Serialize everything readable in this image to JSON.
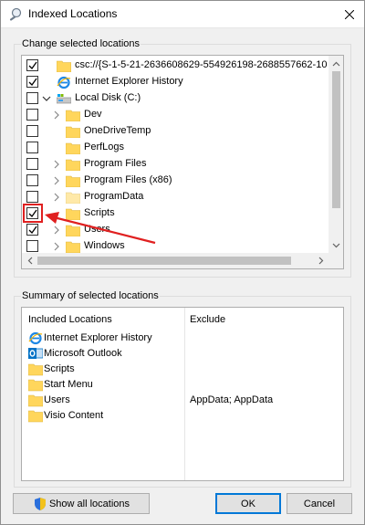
{
  "window": {
    "title": "Indexed Locations"
  },
  "change_group": {
    "label": "Change selected locations",
    "rows": [
      {
        "label": "csc://{S-1-5-21-2636608629-554926198-2688557662-10",
        "checked": true,
        "icon": "folder-icon"
      },
      {
        "label": "Internet Explorer History",
        "checked": true,
        "icon": "internet-explorer-icon"
      },
      {
        "label": "Local Disk (C:)",
        "checked": false,
        "icon": "drive-icon"
      },
      {
        "label": "Dev",
        "checked": false,
        "icon": "folder-icon"
      },
      {
        "label": "OneDriveTemp",
        "checked": false,
        "icon": "folder-icon"
      },
      {
        "label": "PerfLogs",
        "checked": false,
        "icon": "folder-icon"
      },
      {
        "label": "Program Files",
        "checked": false,
        "icon": "folder-icon"
      },
      {
        "label": "Program Files (x86)",
        "checked": false,
        "icon": "folder-icon"
      },
      {
        "label": "ProgramData",
        "checked": false,
        "icon": "folder-icon"
      },
      {
        "label": "Scripts",
        "checked": true,
        "icon": "folder-icon"
      },
      {
        "label": "Users",
        "checked": true,
        "icon": "folder-icon"
      },
      {
        "label": "Windows",
        "checked": false,
        "icon": "folder-icon"
      }
    ]
  },
  "summary_group": {
    "label": "Summary of selected locations",
    "col_included": "Included Locations",
    "col_exclude": "Exclude",
    "rows": [
      {
        "label": "Internet Explorer History",
        "exclude": "",
        "icon": "internet-explorer-icon"
      },
      {
        "label": "Microsoft Outlook",
        "exclude": "",
        "icon": "outlook-icon"
      },
      {
        "label": "Scripts",
        "exclude": "",
        "icon": "folder-icon"
      },
      {
        "label": "Start Menu",
        "exclude": "",
        "icon": "folder-icon"
      },
      {
        "label": "Users",
        "exclude": "AppData; AppData",
        "icon": "folder-icon"
      },
      {
        "label": "Visio Content",
        "exclude": "",
        "icon": "folder-icon"
      }
    ]
  },
  "buttons": {
    "show_all": "Show all locations",
    "ok": "OK",
    "cancel": "Cancel"
  },
  "colors": {
    "accent": "#0078d7",
    "annotation": "#e02020",
    "folder": "#ffd65c"
  }
}
